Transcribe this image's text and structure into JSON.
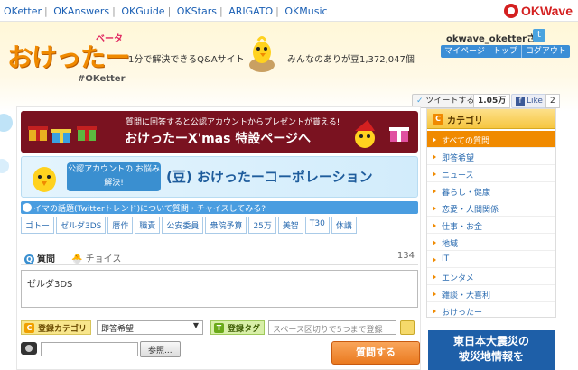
{
  "topnav": {
    "links": [
      "OKetter",
      "OKAnswers",
      "OKGuide",
      "OKStars",
      "ARIGATO",
      "OKMusic"
    ],
    "brand": "OKWave"
  },
  "header": {
    "logo": "おけったー",
    "beta": "ベータ",
    "hashtag": "#OKetter",
    "tagline": "1分で解決できるQ&Aサイト",
    "stat": "みんなのありが豆1,372,047個",
    "username": "okwave_oketterさん",
    "user_menu": [
      "マイページ",
      "トップ",
      "ログアウト"
    ],
    "tweet_label": "ツイートする",
    "tweet_count": "1.05万",
    "like_label": "Like",
    "like_count": "2"
  },
  "banners": {
    "xmas_line1": "質問に回答すると公認アカウントからプレゼントが貰える!",
    "xmas_line2": "おけったーX'mas 特設ページへ",
    "corp_bubble": "公認アカウントの お悩み解決!",
    "corp_title": "(豆) おけったーコーポレーション"
  },
  "trend": {
    "title": "イマの話題(Twitterトレンド)について質問・チャイスしてみる?",
    "tags": [
      "ゴトー",
      "ゼルダ3DS",
      "暦作",
      "職責",
      "公安委員",
      "衆院予算",
      "25万",
      "美智",
      "T30",
      "休講"
    ]
  },
  "question": {
    "tab_question": "質問",
    "tab_choice": "チョイス",
    "char_count": "134",
    "text": "ゼルダ3DS",
    "category_label": "登録カテゴリ",
    "category_value": "即答希望",
    "tag_label": "登録タグ",
    "tag_placeholder": "スペース区切りで5つまで登録",
    "browse_label": "参照...",
    "submit_label": "質問する"
  },
  "sidebar": {
    "title": "カテゴリ",
    "items": [
      "すべての質問",
      "即答希望",
      "ニュース",
      "暮らし・健康",
      "恋愛・人間関係",
      "仕事・お金",
      "地域",
      "IT",
      "エンタメ",
      "雑談・大喜利",
      "おけったー"
    ]
  },
  "quake": {
    "line1": "東日本大震災の",
    "line2": "被災地情報を"
  },
  "colors": {
    "accent": "#f08a00",
    "link": "#2a6bb0",
    "brand": "#d42020"
  }
}
